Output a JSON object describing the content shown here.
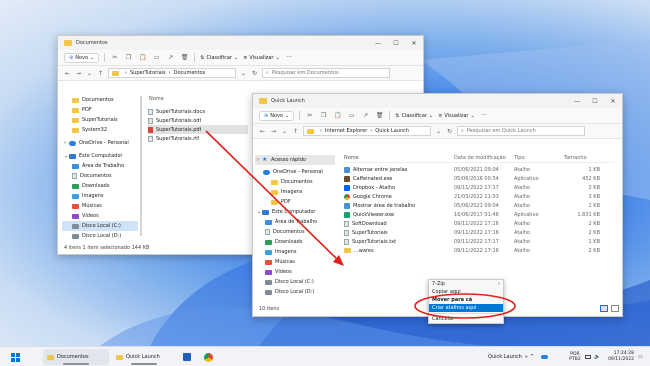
{
  "win1": {
    "title": "Documentos",
    "toolbar": {
      "new": "Novo",
      "sort": "Classificar",
      "view": "Visualizar"
    },
    "breadcrumb": [
      "SuperTutoriais",
      "Documentos"
    ],
    "search_placeholder": "Pesquisar em Documentos",
    "nav_items": [
      {
        "label": "Documentos",
        "icon": "folder"
      },
      {
        "label": "PDF",
        "icon": "folder"
      },
      {
        "label": "SuperTutoriais",
        "icon": "folder"
      },
      {
        "label": "System32",
        "icon": "folder"
      },
      {
        "label": "OneDrive - Personal",
        "icon": "cloud"
      },
      {
        "label": "Este Computador",
        "icon": "pc"
      },
      {
        "label": "Área de Trabalho",
        "icon": "desktop"
      },
      {
        "label": "Documentos",
        "icon": "doc"
      },
      {
        "label": "Downloads",
        "icon": "download"
      },
      {
        "label": "Imagens",
        "icon": "image"
      },
      {
        "label": "Músicas",
        "icon": "music"
      },
      {
        "label": "Vídeos",
        "icon": "video"
      },
      {
        "label": "Disco Local (C:)",
        "icon": "drive"
      },
      {
        "label": "Disco Local (D:)",
        "icon": "drive"
      }
    ],
    "column_name": "Nome",
    "files": [
      "SuperTutoriais.docx",
      "SuperTutoriais.odt",
      "SuperTutoriais.pdf",
      "SuperTutoriais.rtf"
    ],
    "status": "4 itens   1 item selecionado  144 KB"
  },
  "win2": {
    "title": "Quick Launch",
    "toolbar": {
      "new": "Novo",
      "sort": "Classificar",
      "view": "Visualizar"
    },
    "breadcrumb": [
      "Internet Explorer",
      "Quick Launch"
    ],
    "search_placeholder": "Pesquisar em Quick Launch",
    "nav_items": [
      {
        "label": "Acesso rápido",
        "icon": "star"
      },
      {
        "label": "OneDrive - Personal",
        "icon": "cloud"
      },
      {
        "label": "Documentos",
        "icon": "folder"
      },
      {
        "label": "Imagens",
        "icon": "folder"
      },
      {
        "label": "PDF",
        "icon": "folder"
      },
      {
        "label": "Este Computador",
        "icon": "pc"
      },
      {
        "label": "Área de Trabalho",
        "icon": "desktop"
      },
      {
        "label": "Documentos",
        "icon": "doc"
      },
      {
        "label": "Downloads",
        "icon": "download"
      },
      {
        "label": "Imagens",
        "icon": "image"
      },
      {
        "label": "Músicas",
        "icon": "music"
      },
      {
        "label": "Vídeos",
        "icon": "video"
      },
      {
        "label": "Disco Local (C:)",
        "icon": "drive"
      },
      {
        "label": "Disco Local (D:)",
        "icon": "drive"
      }
    ],
    "columns": {
      "name": "Nome",
      "date": "Data de modificação",
      "type": "Tipo",
      "size": "Tamanho"
    },
    "files": [
      {
        "name": "Alternar entre janelas",
        "date": "05/06/2021 09:04",
        "type": "Atalho",
        "size": "1 KB",
        "icon": "exe"
      },
      {
        "name": "Caffeinated.exe",
        "date": "05/06/2016 00:54",
        "type": "Aplicativo",
        "size": "452 KB",
        "icon": "exe"
      },
      {
        "name": "Dropbox - Atalho",
        "date": "09/11/2022 17:17",
        "type": "Atalho",
        "size": "2 KB",
        "icon": "exe"
      },
      {
        "name": "Google Chrome",
        "date": "21/03/2022 11:33",
        "type": "Atalho",
        "size": "3 KB",
        "icon": "exe"
      },
      {
        "name": "Mostrar área de trabalho",
        "date": "05/06/2021 09:04",
        "type": "Atalho",
        "size": "1 KB",
        "icon": "exe"
      },
      {
        "name": "QuickViewer.exe",
        "date": "16/06/2017 01:48",
        "type": "Aplicativo",
        "size": "1.831 KB",
        "icon": "exe"
      },
      {
        "name": "SoftDownload",
        "date": "09/11/2022 17:16",
        "type": "Atalho",
        "size": "2 KB",
        "icon": "exe"
      },
      {
        "name": "SuperTutoriais",
        "date": "09/11/2022 17:16",
        "type": "Atalho",
        "size": "2 KB",
        "icon": "exe"
      },
      {
        "name": "SuperTutoriais.txt",
        "date": "09/11/2022 17:17",
        "type": "Atalho",
        "size": "1 KB",
        "icon": "exe"
      },
      {
        "name": "...wares",
        "date": "09/11/2022 17:16",
        "type": "Atalho",
        "size": "2 KB",
        "icon": "folder"
      }
    ],
    "status": "10 itens"
  },
  "context_menu": {
    "items": [
      "7-Zip",
      "Copiar aqui",
      "Mover para cá",
      "Criar atalhos aqui",
      "Cancelar"
    ]
  },
  "taskbar": {
    "explorer_label": "Documentos",
    "quicklaunch_label": "Quick Launch",
    "toolbar_label": "Quick Launch",
    "lang": "POR",
    "lang2": "PTB2",
    "time": "17:24:28",
    "date": "09/11/2022"
  },
  "colors": {
    "accent": "#0078d4",
    "annotation_red": "#e0201b",
    "folder": "#f2c54b"
  }
}
